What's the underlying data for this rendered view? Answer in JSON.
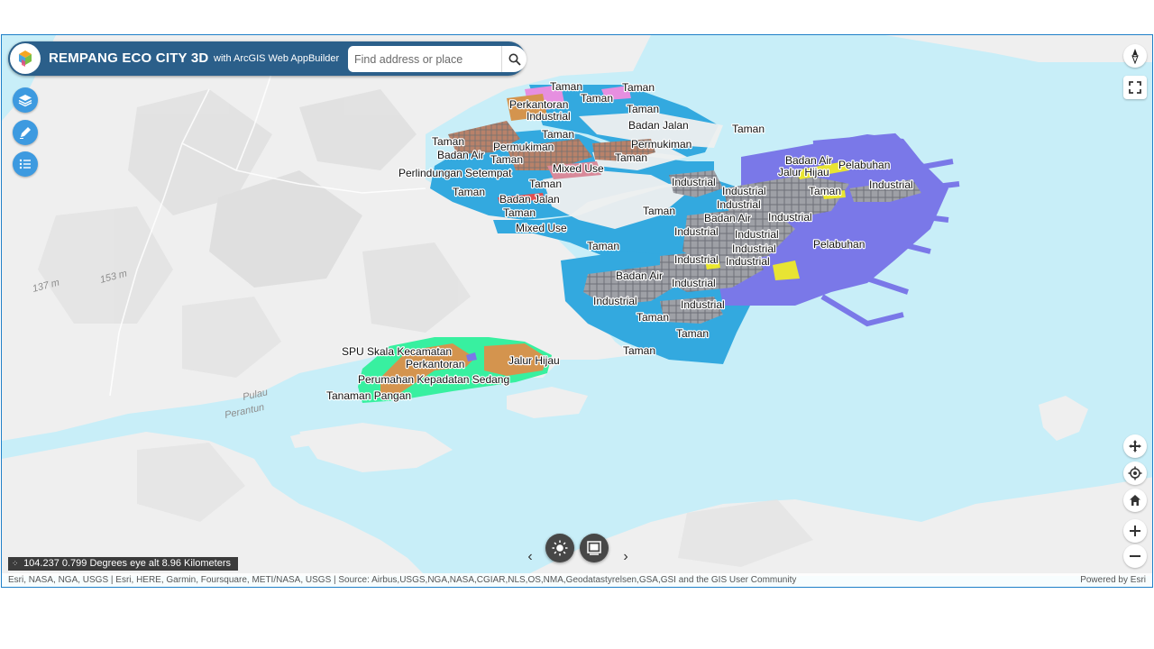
{
  "app": {
    "title": "REMPANG ECO CITY 3D",
    "subtitle": "with ArcGIS Web AppBuilder"
  },
  "search": {
    "placeholder": "Find address or place",
    "value": ""
  },
  "left_widgets": [
    {
      "name": "layers-icon"
    },
    {
      "name": "draw-icon"
    },
    {
      "name": "legend-icon"
    }
  ],
  "map_labels": [
    "Taman",
    "Taman",
    "Taman",
    "Perkantoran",
    "Industrial",
    "Taman",
    "Badan Jalan",
    "Taman",
    "Taman",
    "Permukiman",
    "Taman",
    "Permukiman",
    "Badan Air",
    "Taman",
    "Mixed Use",
    "Taman",
    "Perlindungan Setempat",
    "Taman",
    "Badan Air",
    "Pelabuhan",
    "Jalur Hijau",
    "Industrial",
    "Industrial",
    "Taman",
    "Industrial",
    "Taman",
    "Badan Jalan",
    "Industrial",
    "Taman",
    "Taman",
    "Badan Air",
    "Industrial",
    "Mixed Use",
    "Industrial",
    "Industrial",
    "Taman",
    "Industrial",
    "Pelabuhan",
    "Industrial",
    "Industrial",
    "Badan Air",
    "Industrial",
    "Industrial",
    "Taman",
    "Industrial",
    "Taman",
    "Taman",
    "SPU Skala Kecamatan",
    "Perkantoran",
    "Jalur Hijau",
    "Perumahan Kepadatan Sedang",
    "Tanaman Pangan"
  ],
  "terrain_labels": {
    "island": "Pulau",
    "island2": "Perantun",
    "elev1": "137 m",
    "elev2": "153 m"
  },
  "coordinate_readout": "104.237 0.799 Degrees  eye alt 8.96 Kilometers",
  "attribution": "Esri, NASA, NGA, USGS | Esri, HERE, Garmin, Foursquare, METI/NASA, USGS | Source: Airbus,USGS,NGA,NASA,CGIAR,NLS,OS,NMA,Geodatastyrelsen,GSA,GSI and the GIS User Community",
  "powered_by": "Powered by Esri",
  "colors": {
    "water": "#c8eef8",
    "land": "#efefef",
    "taman": "#33a9df",
    "pelabuhan": "#7a78e8",
    "industrial": "#9ea0a6",
    "pangan": "#38f0a0",
    "perumahan": "#d4944e",
    "header": "#2b5f8a",
    "widget": "#3d9ae0"
  }
}
